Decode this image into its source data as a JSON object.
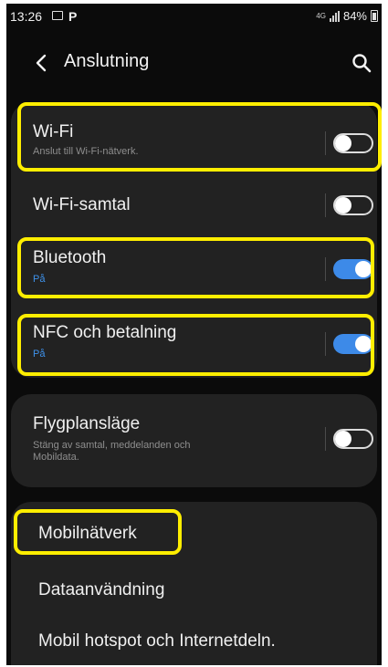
{
  "status_bar": {
    "time": "13:26",
    "extra": "P",
    "network": "4G",
    "battery": "84%"
  },
  "header": {
    "title": "Anslutning"
  },
  "settings": {
    "wifi": {
      "title": "Wi-Fi",
      "subtitle": "Anslut till Wi-Fi-nätverk.",
      "enabled": false
    },
    "wifi_calling": {
      "title": "Wi-Fi-samtal",
      "enabled": false
    },
    "bluetooth": {
      "title": "Bluetooth",
      "subtitle": "På",
      "enabled": true
    },
    "nfc": {
      "title": "NFC och betalning",
      "subtitle": "På",
      "enabled": true
    },
    "airplane": {
      "title": "Flygplansläge",
      "subtitle_line1": "Stäng av samtal, meddelanden och",
      "subtitle_line2": "Mobildata.",
      "enabled": false
    },
    "mobile_networks": {
      "title": "Mobilnätverk"
    },
    "data_usage": {
      "title": "Dataanvändning"
    },
    "hotspot": {
      "title": "Mobil hotspot och Internetdeln."
    }
  },
  "colors": {
    "background": "#0b0b0b",
    "card": "#222222",
    "accent_on": "#3d8ae8",
    "highlight": "#ffee00"
  }
}
